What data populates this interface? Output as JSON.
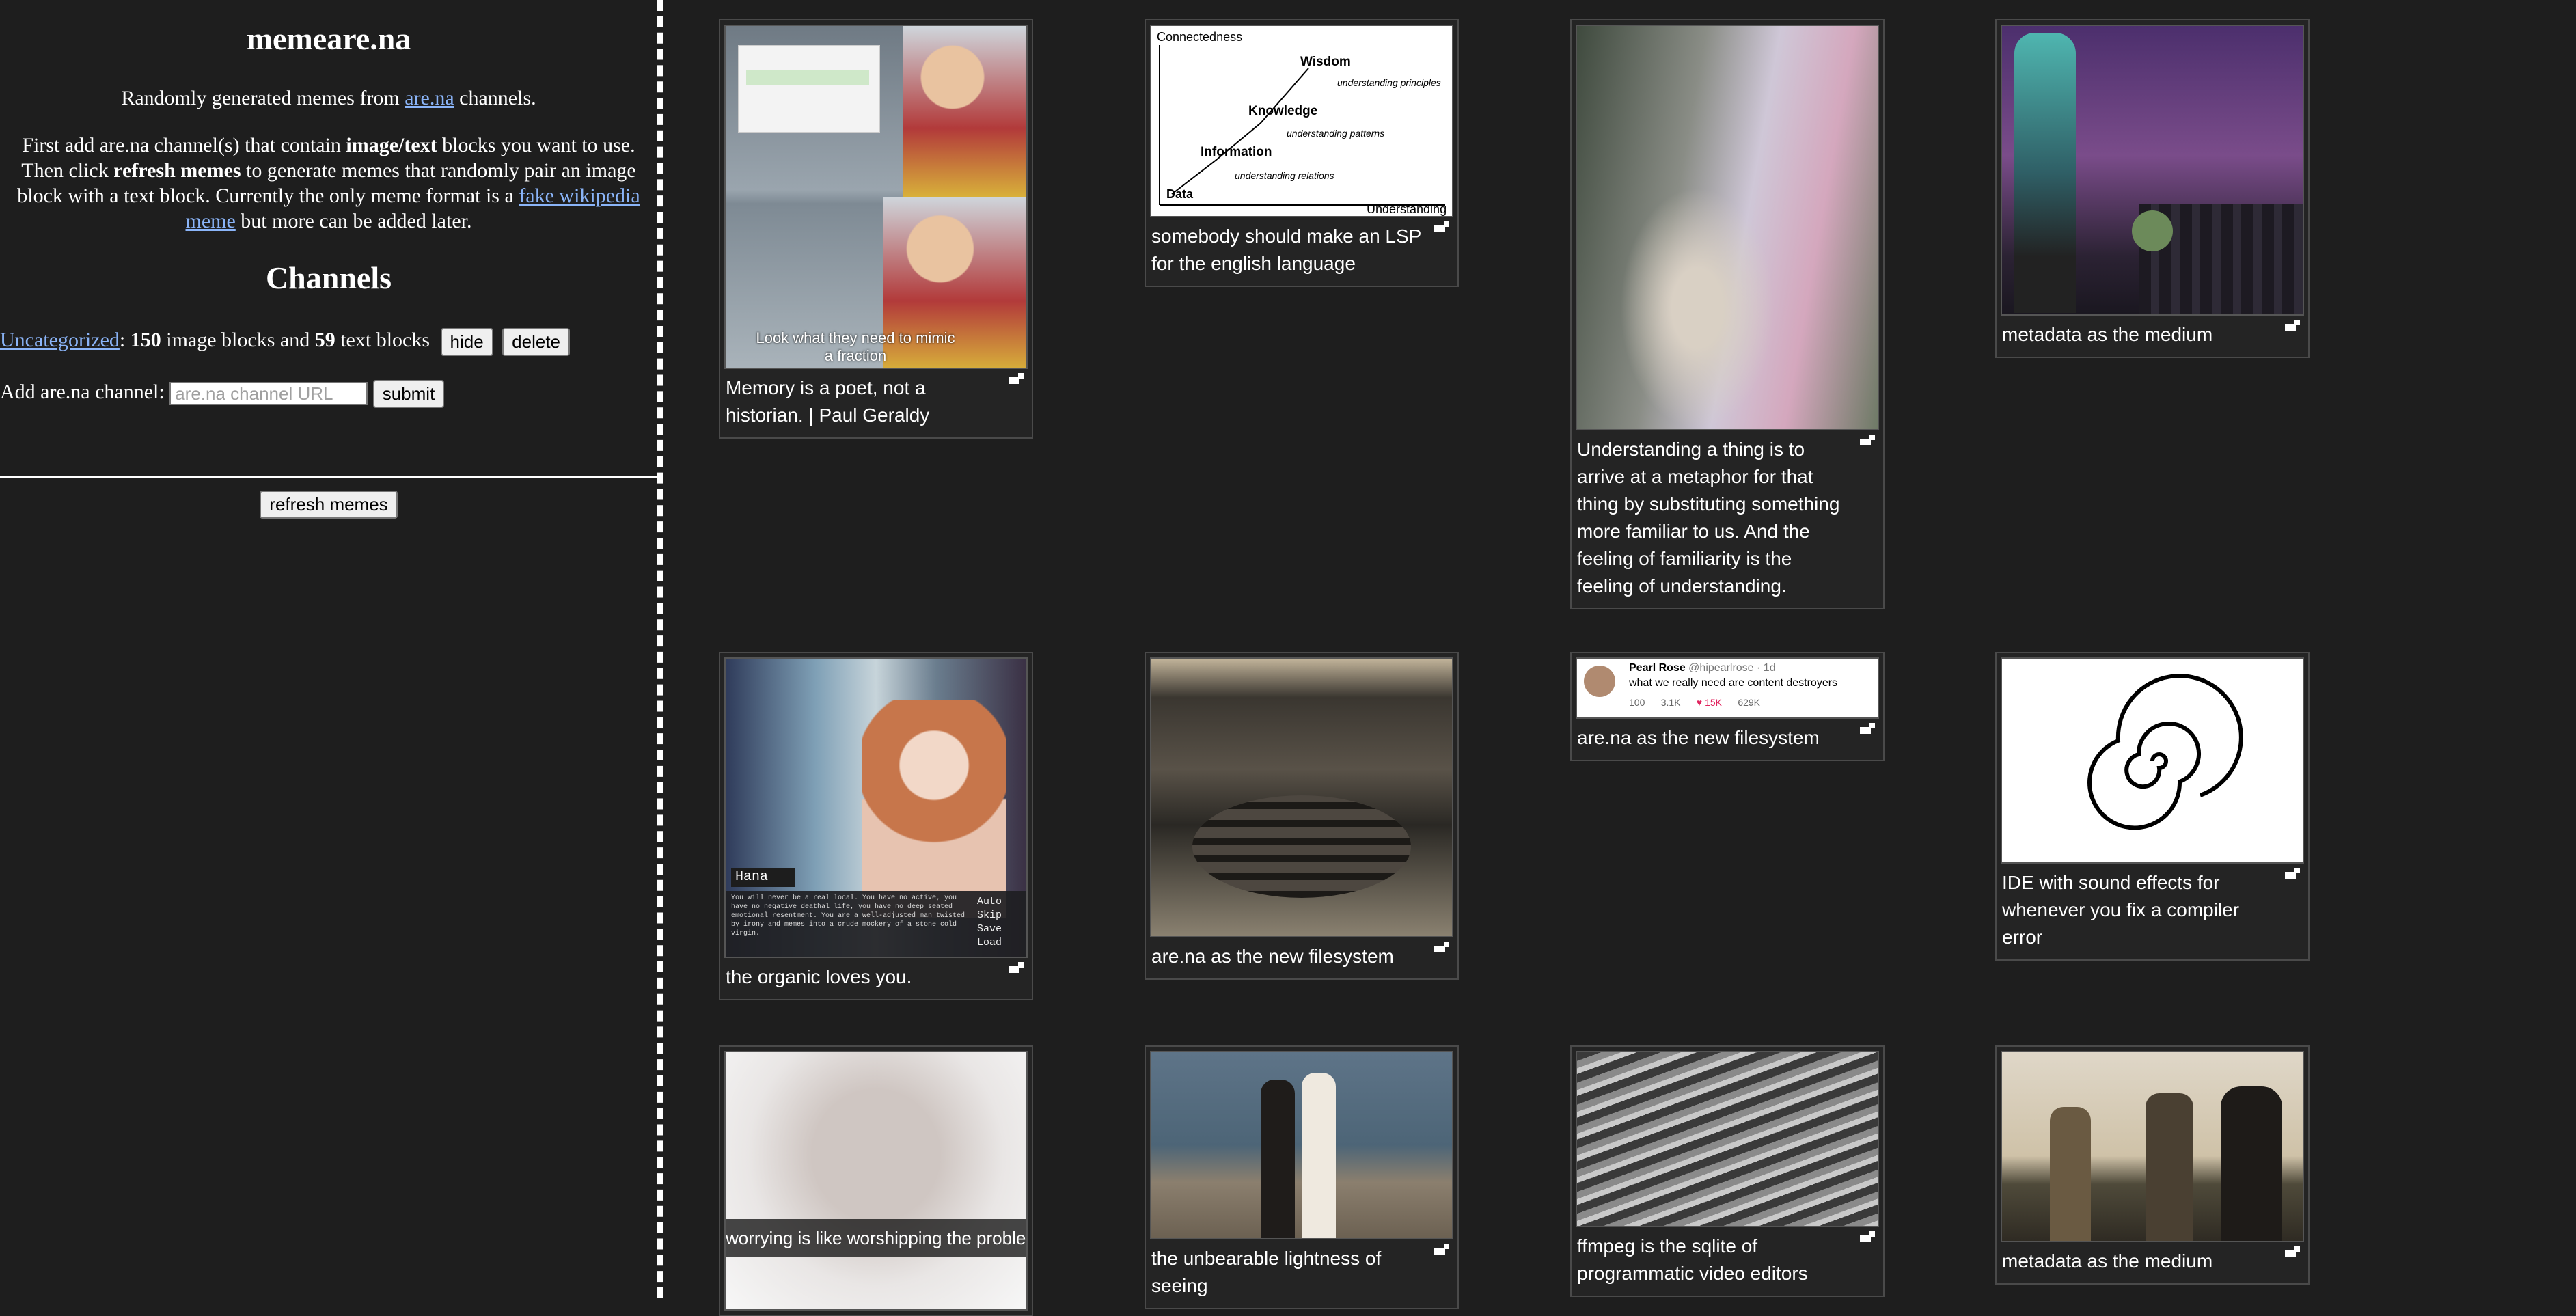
{
  "sidebar": {
    "title": "memeare.na",
    "tagline_prefix": "Randomly generated memes from ",
    "tagline_link": "are.na",
    "tagline_suffix": " channels.",
    "instr_1": "First add are.na channel(s) that contain ",
    "instr_bold_1": "image/text",
    "instr_2": " blocks you want to use. Then click ",
    "instr_bold_2": "refresh memes",
    "instr_3": " to generate memes that randomly pair an image block with a text block. Currently the only meme format is a ",
    "instr_link": "fake wikipedia meme",
    "instr_4": " but more can be added later.",
    "channels_heading": "Channels",
    "channel": {
      "name": "Uncategorized",
      "image_count": "150",
      "text_a": " image blocks and ",
      "text_count": "59",
      "text_b": " text blocks",
      "hide_label": "hide",
      "delete_label": "delete"
    },
    "add_label": "Add are.na channel:",
    "add_placeholder": "are.na channel URL",
    "submit_label": "submit",
    "refresh_label": "refresh memes"
  },
  "cards": [
    {
      "caption": "Memory is a poet, not a historian. | Paul Geraldy",
      "overlay": "Look what they need to mimic a fraction"
    },
    {
      "caption": "somebody should make an LSP for the english language",
      "chart_labels": [
        "Connectedness",
        "Wisdom",
        "understanding principles",
        "Knowledge",
        "understanding patterns",
        "Information",
        "understanding relations",
        "Data",
        "Understanding"
      ]
    },
    {
      "caption": "Understanding a thing is to arrive at a metaphor for that thing by substituting something more familiar to us. And the feeling of familiarity is the feeling of understanding."
    },
    {
      "caption": "metadata as the medium"
    },
    {
      "caption": "the organic loves you.",
      "overlay_name": "Hana",
      "overlay_text": "You will never be a real local. You have no active, you have no negative deathal life, you have no deep seated emotional resentment. You are a well-adjusted man twisted by irony and memes into a crude mockery of a stone cold virgin.",
      "overlay_menu": "Auto Skip Save Load"
    },
    {
      "caption": "are.na as the new filesystem"
    },
    {
      "caption": "are.na as the new filesystem",
      "tweet_name": "Pearl Rose",
      "tweet_handle": "@hipearlrose · 1d",
      "tweet_text": "what we really need are content destroyers",
      "tweet_stats": [
        "100",
        "3.1K",
        "15K",
        "629K"
      ]
    },
    {
      "caption": "IDE with sound effects for whenever you fix a compiler error"
    },
    {
      "caption": "",
      "overlay": "worrying is like worshipping the problem"
    },
    {
      "caption": "the unbearable lightness of seeing"
    },
    {
      "caption": "ffmpeg is the sqlite of programmatic video editors"
    },
    {
      "caption": "metadata as the medium"
    }
  ],
  "colors": {
    "background": "#1e1e1e",
    "link": "#8ab4f8",
    "card_border": "#4a4a4a"
  }
}
